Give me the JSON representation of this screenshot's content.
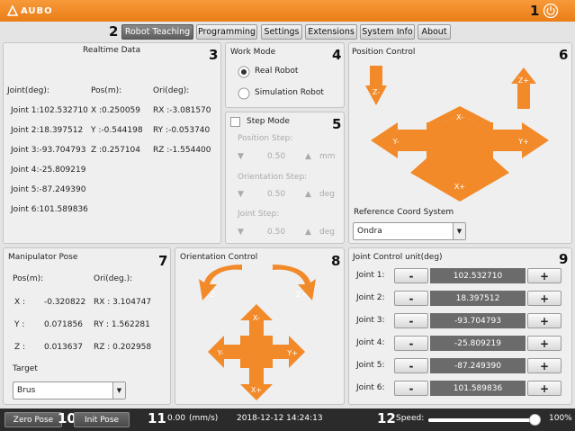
{
  "app": {
    "logo_text": "AUBO"
  },
  "callouts": [
    "1",
    "2",
    "3",
    "4",
    "5",
    "6",
    "7",
    "8",
    "9",
    "10",
    "11",
    "12"
  ],
  "tabs": [
    "Robot Teaching",
    "Programming",
    "Settings",
    "Extensions",
    "System Info",
    "About"
  ],
  "realtime": {
    "title": "Realtime Data",
    "joint_header": "Joint(deg):",
    "pos_header": "Pos(m):",
    "ori_header": "Ori(deg):",
    "joints": [
      "Joint 1:102.532710",
      "Joint 2:18.397512",
      "Joint 3:-93.704793",
      "Joint 4:-25.809219",
      "Joint 5:-87.249390",
      "Joint 6:101.589836"
    ],
    "pos": [
      "X :0.250059",
      "Y :-0.544198",
      "Z :0.257104"
    ],
    "ori": [
      "RX :-3.081570",
      "RY :-0.053740",
      "RZ :-1.554400"
    ]
  },
  "workmode": {
    "title": "Work Mode",
    "options": [
      "Real Robot",
      "Simulation Robot"
    ],
    "selected": "Real Robot"
  },
  "stepmode": {
    "title": "Step Mode",
    "position_label": "Position Step:",
    "position_value": "0.50",
    "position_unit": "mm",
    "orientation_label": "Orientation Step:",
    "orientation_value": "0.50",
    "orientation_unit": "deg",
    "joint_label": "Joint Step:",
    "joint_value": "0.50",
    "joint_unit": "deg"
  },
  "position_control": {
    "title": "Position Control",
    "arrows": [
      "Z-",
      "Z+",
      "X-",
      "Y-",
      "Y+",
      "X+"
    ],
    "coord_label": "Reference Coord System",
    "coord_value": "Ondra"
  },
  "manipulator": {
    "title": "Manipulator Pose",
    "pos_header": "Pos(m):",
    "ori_header": "Ori(deg.):",
    "rows": [
      {
        "axis": "X :",
        "pos": "-0.320822",
        "ori": "RX : 3.104747"
      },
      {
        "axis": "Y :",
        "pos": "0.071856",
        "ori": "RY : 1.562281"
      },
      {
        "axis": "Z :",
        "pos": "0.013637",
        "ori": "RZ : 0.202958"
      }
    ],
    "target_label": "Target",
    "target_value": "Brus"
  },
  "orientation_control": {
    "title": "Orientation Control",
    "arrows": [
      "Z-",
      "Z+",
      "X-",
      "Y-",
      "Y+",
      "X+"
    ]
  },
  "joint_control": {
    "title": "Joint Control  unit(deg)",
    "minus": "-",
    "plus": "+",
    "joints": [
      {
        "label": "Joint 1:",
        "value": "102.532710"
      },
      {
        "label": "Joint 2:",
        "value": "18.397512"
      },
      {
        "label": "Joint 3:",
        "value": "-93.704793"
      },
      {
        "label": "Joint 4:",
        "value": "-25.809219"
      },
      {
        "label": "Joint 5:",
        "value": "-87.249390"
      },
      {
        "label": "Joint 6:",
        "value": "101.589836"
      }
    ]
  },
  "bottom": {
    "zero_pose": "Zero Pose",
    "init_pose": "Init Pose",
    "speed_value": "0.00",
    "speed_unit": "(mm/s)",
    "datetime": "2018-12-12 14:24:13",
    "speed_label": "Speed:",
    "speed_percent": "100%",
    "speed_fraction": 1.0
  },
  "colors": {
    "accent": "#f28a2a",
    "arrow": "#f28a2a"
  }
}
